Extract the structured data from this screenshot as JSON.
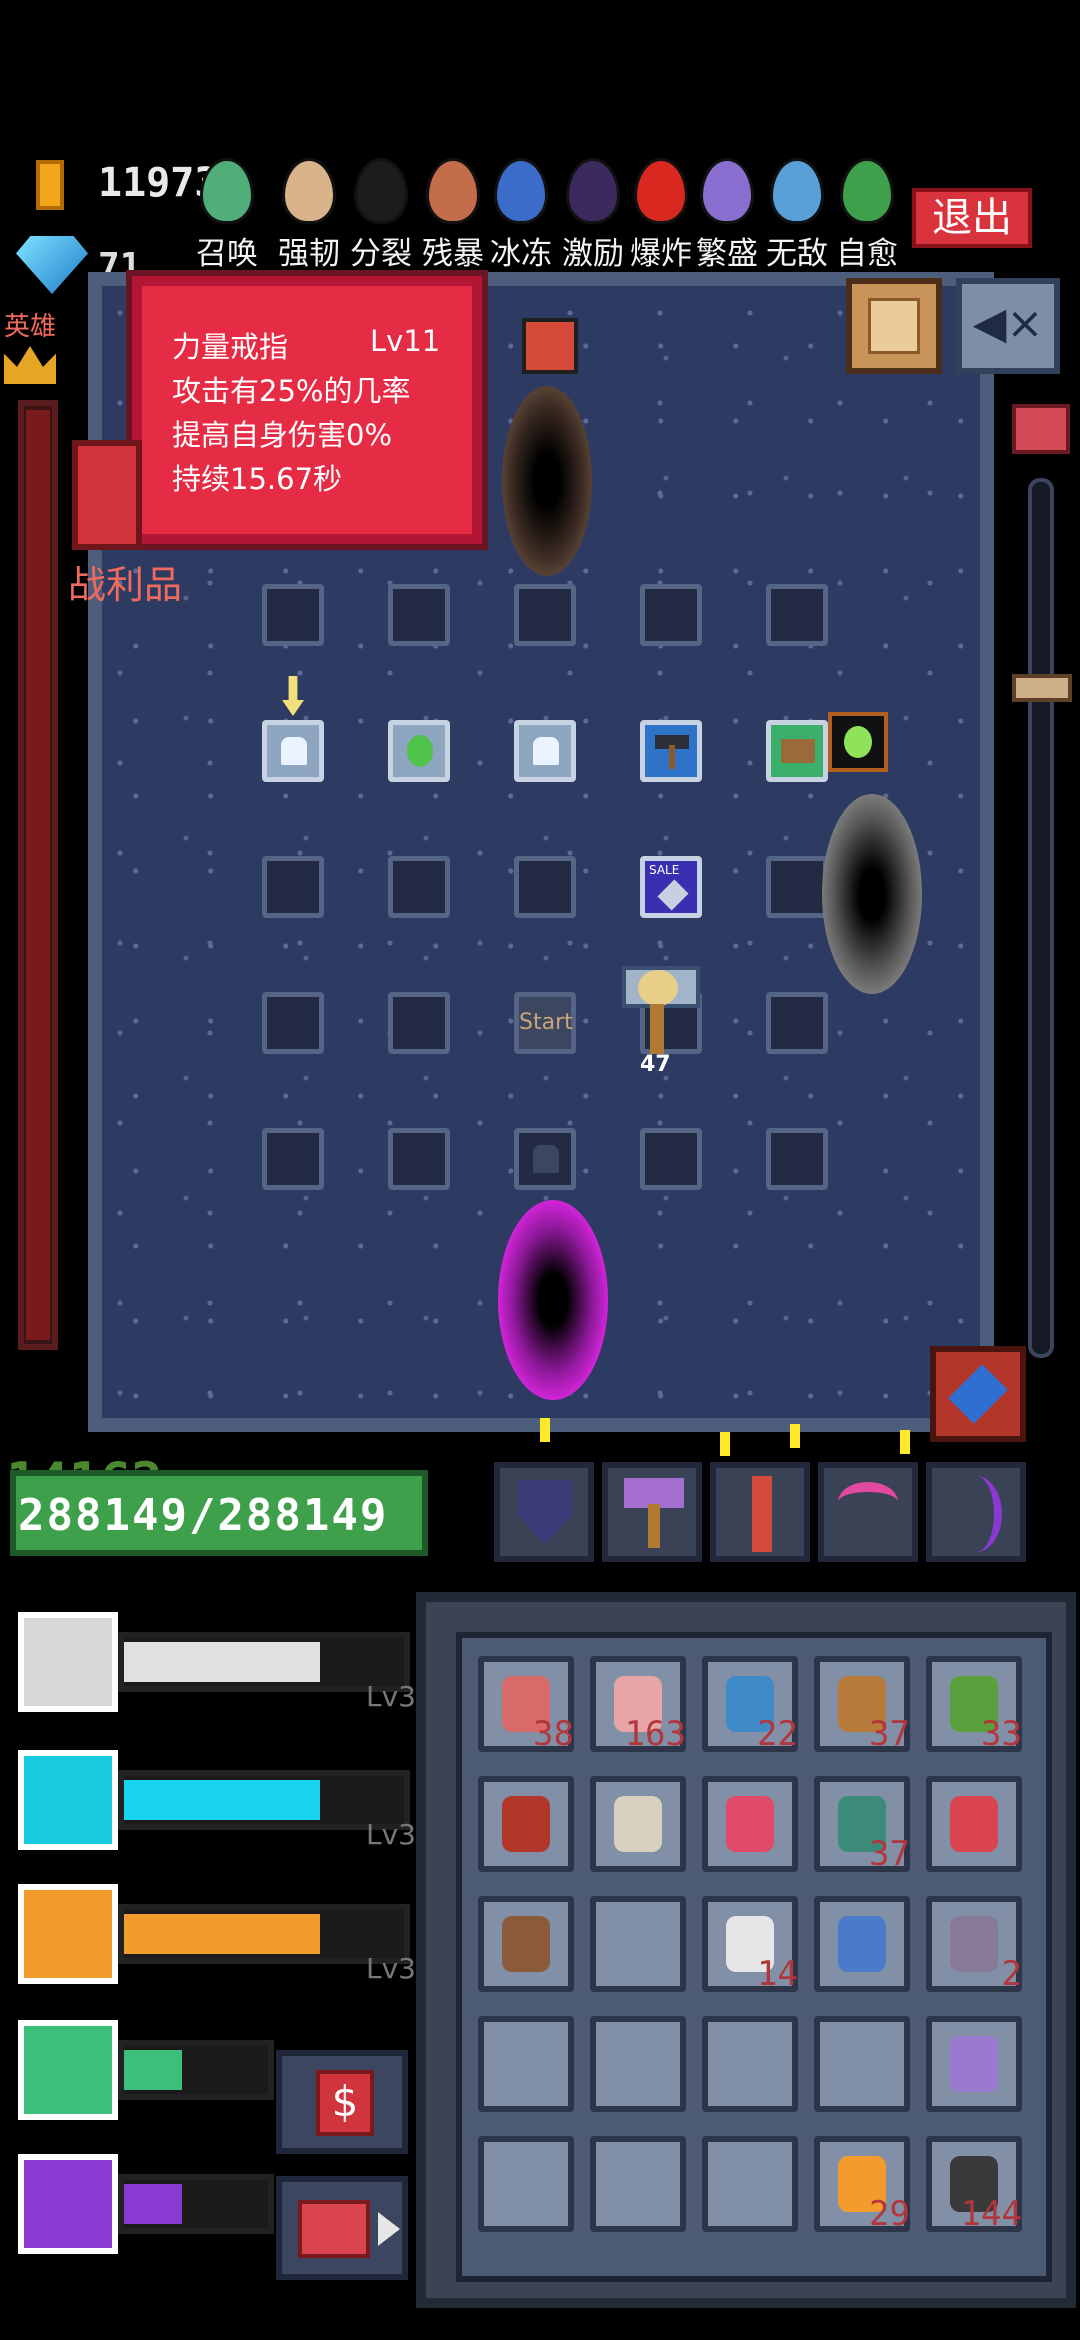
{
  "topbar": {
    "gold": "11973",
    "gems": "71",
    "exit_label": "退出",
    "eggs": [
      {
        "label": "召唤",
        "color": "#4fae7a"
      },
      {
        "label": "强韧",
        "color": "#d9b48a"
      },
      {
        "label": "分裂",
        "color": "#1c1c1c"
      },
      {
        "label": "残暴",
        "color": "#c46d4a"
      },
      {
        "label": "冰冻",
        "color": "#3b6cc9"
      },
      {
        "label": "激励",
        "color": "#3a2a5e"
      },
      {
        "label": "爆炸",
        "color": "#d8281f"
      },
      {
        "label": "繁盛",
        "color": "#8a6fd0"
      },
      {
        "label": "无敌",
        "color": "#5aa0d8"
      },
      {
        "label": "自愈",
        "color": "#3fa04c"
      }
    ]
  },
  "left": {
    "hero_label": "英雄",
    "loot_label": "战利品"
  },
  "tooltip": {
    "name": "力量戒指",
    "level": "Lv11",
    "line1": "攻击有25%的几率",
    "line2": "提高自身伤害0%",
    "line3": "持续15.67秒"
  },
  "board": {
    "start_label": "Start",
    "sale_label": "SALE",
    "player_number": "47"
  },
  "player": {
    "hp_ghost": "14162",
    "hp_text": "288149/288149"
  },
  "skills": [
    {
      "level": "Lv3",
      "color": "#d8d8d8",
      "bar": "#e0e0e0",
      "fill": 0.7,
      "icon": "bomb-skill-icon"
    },
    {
      "level": "Lv3",
      "color": "#19c9e0",
      "bar": "#19d4ee",
      "fill": 0.7,
      "icon": "axe-skill-icon"
    },
    {
      "level": "Lv3",
      "color": "#f39b2c",
      "bar": "#f39b2c",
      "fill": 0.7,
      "icon": "crossed-swords-skill-icon"
    },
    {
      "level": "",
      "color": "#3cbf7a",
      "bar": "#3cbf7a",
      "fill": 0.4,
      "icon": "arrows-skill-icon"
    },
    {
      "level": "",
      "color": "#8a3ad0",
      "bar": "#8a3ad0",
      "fill": 0.4,
      "icon": "triple-arrow-skill-icon"
    }
  ],
  "inventory": [
    [
      "38",
      "163",
      "22",
      "37",
      "33"
    ],
    [
      "",
      "",
      "",
      "37",
      ""
    ],
    [
      "",
      "",
      "14",
      "",
      "2"
    ],
    [
      "",
      "",
      "",
      "",
      ""
    ],
    [
      "",
      "",
      "",
      "29",
      "144"
    ]
  ],
  "colors": {
    "board_bg": "#2d3a62",
    "tooltip_bg": "#e62b44",
    "hp_green": "#3fa04c"
  }
}
